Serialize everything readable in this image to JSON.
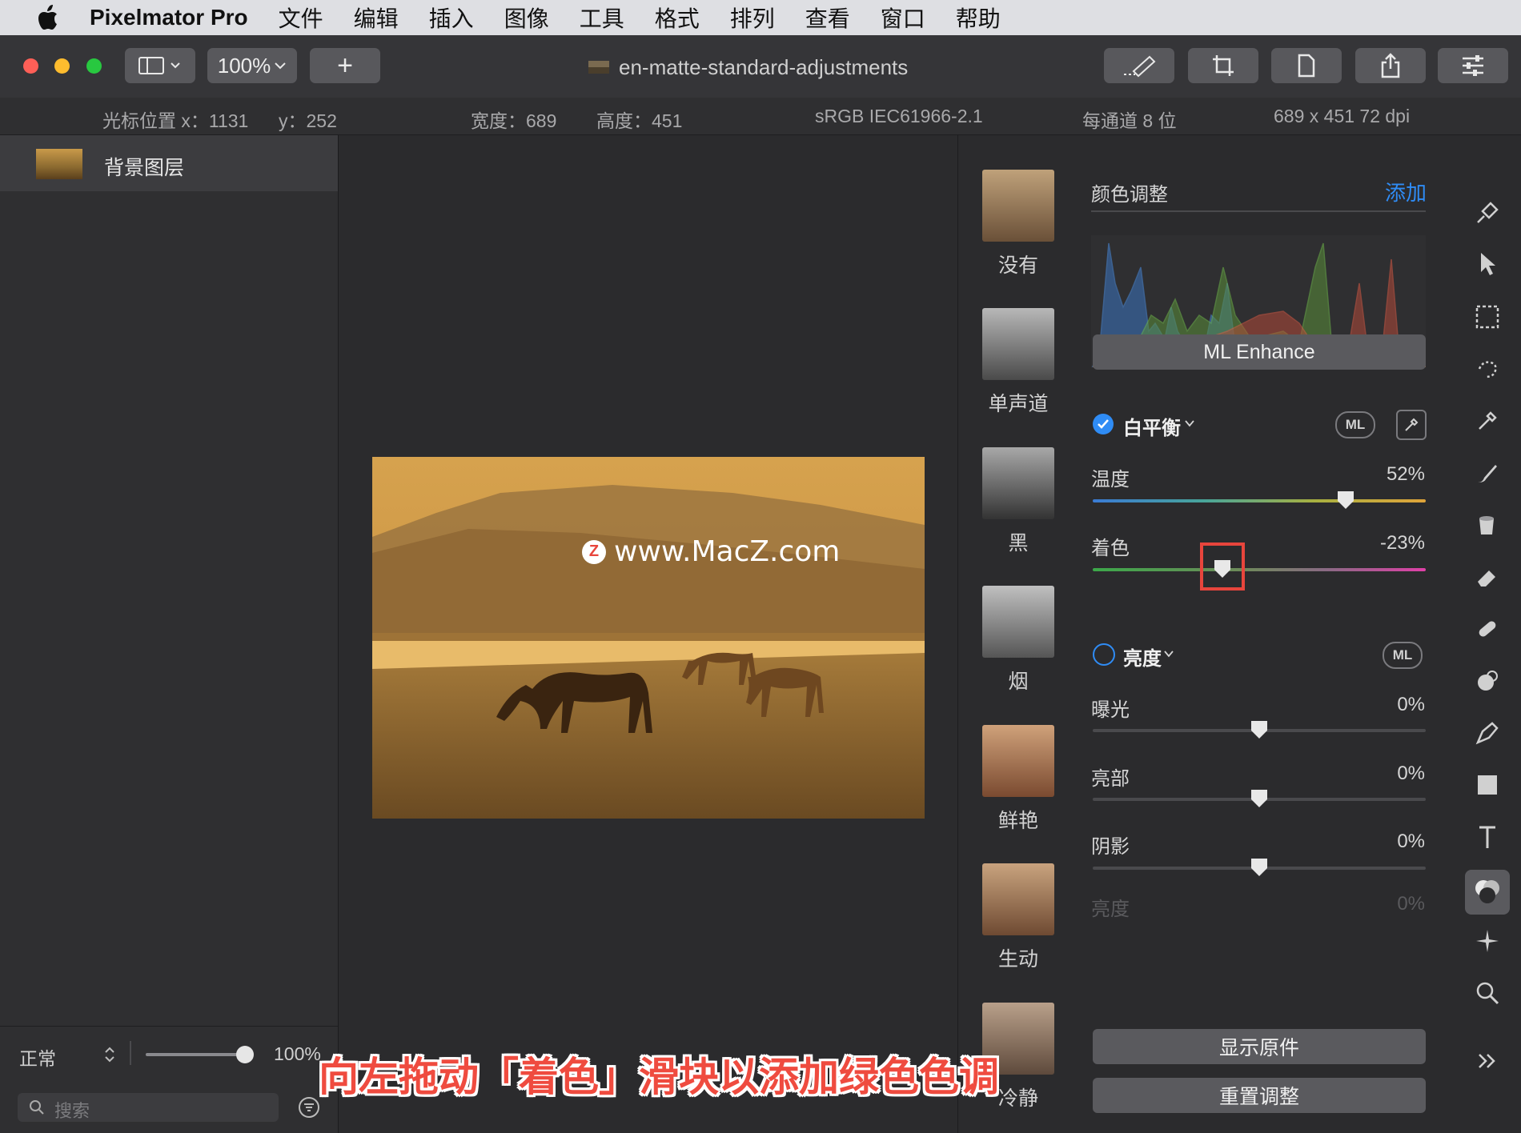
{
  "menubar": {
    "app_name": "Pixelmator Pro",
    "items": [
      "文件",
      "编辑",
      "插入",
      "图像",
      "工具",
      "格式",
      "排列",
      "查看",
      "窗口",
      "帮助"
    ]
  },
  "toolbar": {
    "zoom": "100%",
    "add_label": "+",
    "document_title": "en-matte-standard-adjustments",
    "icons": [
      "sidebar-icon",
      "paint-icon",
      "crop-icon",
      "document-icon",
      "share-icon",
      "adjustments-icon"
    ]
  },
  "infobar": {
    "cursor_x": "光标位置 x：1131",
    "cursor_y": "y：252",
    "width": "宽度：689",
    "height": "高度：451",
    "color_profile": "sRGB IEC61966-2.1",
    "bit_depth": "每通道 8 位",
    "dimensions": "689 x 451 72 dpi"
  },
  "layers": {
    "items": [
      {
        "name": "背景图层"
      }
    ],
    "blend_mode": "正常",
    "opacity": "100%",
    "opacity_level": 1.0,
    "search_placeholder": "搜索"
  },
  "canvas": {
    "watermark": "www.MacZ.com"
  },
  "presets": [
    "没有",
    "单声道",
    "黑",
    "烟",
    "鲜艳",
    "生动",
    "冷静"
  ],
  "adjustments": {
    "section_title": "颜色调整",
    "add_label": "添加",
    "ml_enhance": "ML Enhance",
    "white_balance": {
      "title": "白平衡",
      "enabled": true,
      "ml_label": "ML",
      "temperature": {
        "label": "温度",
        "value": "52%",
        "level": 0.76
      },
      "tint": {
        "label": "着色",
        "value": "-23%",
        "level": 0.39
      }
    },
    "brightness": {
      "title": "亮度",
      "enabled": false,
      "ml_label": "ML",
      "exposure": {
        "label": "曝光",
        "value": "0%",
        "level": 0.5
      },
      "highlights": {
        "label": "亮部",
        "value": "0%",
        "level": 0.5
      },
      "shadows": {
        "label": "阴影",
        "value": "0%",
        "level": 0.5
      },
      "brightness_faded": {
        "label": "亮度",
        "value": "0%"
      }
    },
    "show_original": "显示原件",
    "reset": "重置调整"
  },
  "caption": "向左拖动「着色」滑块以添加绿色色调",
  "colors": {
    "accent": "#2f8cf5",
    "highlight_box": "#e8453c",
    "caption": "#ef4b3f"
  }
}
